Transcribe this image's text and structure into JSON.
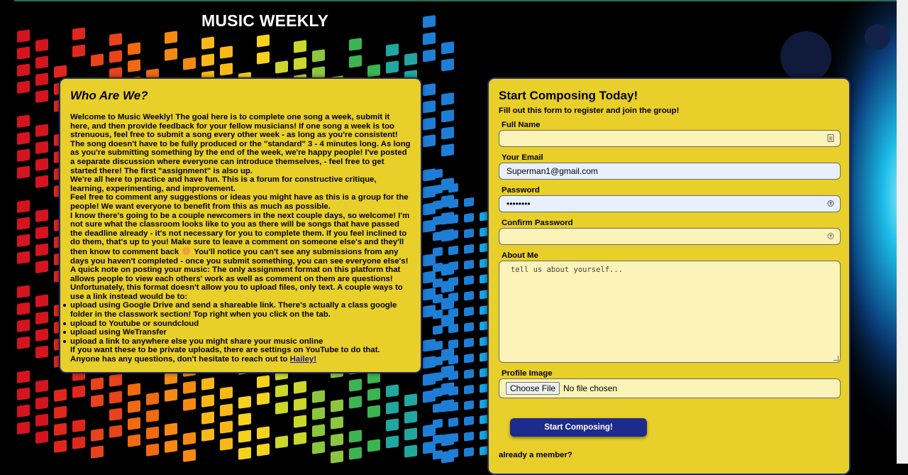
{
  "site": {
    "title": "MUSIC WEEKLY"
  },
  "about": {
    "heading": "Who Are We?",
    "p1": "Welcome to Music Weekly! The goal here is to complete one song a week, submit it here, and then provide feedback for your fellow musicians! If one song a week is too strenuous, feel free to submit a song every other week - as long as you're consistent! The song doesn't have to be fully produced or the \"standard\" 3 - 4 minutes long. As long as you're submitting something by the end of the week, we're happy people! I've posted a separate discussion where everyone can introduce themselves, - feel free to get started there! The first \"assignment\" is also up.",
    "p2": "We're all here to practice and have fun. This is a forum for constructive critique, learning, experimenting, and improvement.",
    "p3": "Feel free to comment any suggestions or ideas you might have as this is a group for the people! We want everyone to benefit from this as much as possible.",
    "p4a": "I know there's going to be a couple newcomers in the next couple days, so welcome! I'm not sure what the classroom looks like to you as there will be songs that have passed the deadline already - it's not necessary for you to complete them. If you feel inclined to do them, that's up to you! Make sure to leave a comment on someone else's and they'll then know to comment back",
    "p4b": "You'll notice you can't see any submissions from any days you haven't completed - once you submit something, you can see everyone else's!",
    "p5": "A quick note on posting your music: The only assignment format on this platform that allows people to view each others' work as well as comment on them are questions! Unfortunately, this format doesn't allow you to upload files, only text. A couple ways to use a link instead would be to:",
    "list": [
      "upload using Google Drive and send a shareable link. There's actually a class google folder in the classwork section! Top right when you click on the tab.",
      "upload to Youtube or soundcloud",
      "upload using WeTransfer",
      "upload a link to anywhere else you might share your music online"
    ],
    "p6": "If you want these to be private uploads, there are settings on YouTube to do that. Anyone has any questions, don't hesitate to reach out to",
    "link": "Hailey!"
  },
  "form": {
    "heading": "Start Composing Today!",
    "subheading": "Fill out this form to register and join the group!",
    "full_name_label": "Full Name",
    "full_name_value": "",
    "email_label": "Your Email",
    "email_value": "Superman1@gmail.com",
    "password_label": "Password",
    "password_value": "••••••••",
    "confirm_label": "Confirm Password",
    "confirm_value": "",
    "about_label": "About Me",
    "about_placeholder": "tell us about yourself...",
    "image_label": "Profile Image",
    "file_button": "Choose File",
    "file_status": "No file chosen",
    "submit": "Start Composing!",
    "member_text": "already a member?"
  },
  "icons": {
    "name_field": "contact-card-icon",
    "password_field": "key-icon"
  },
  "colors": {
    "card": "#e8cf2a",
    "border": "#1f2a6b",
    "button": "#1d2a8e",
    "input": "#fbf3b8",
    "autofill": "#e8f0fe"
  }
}
